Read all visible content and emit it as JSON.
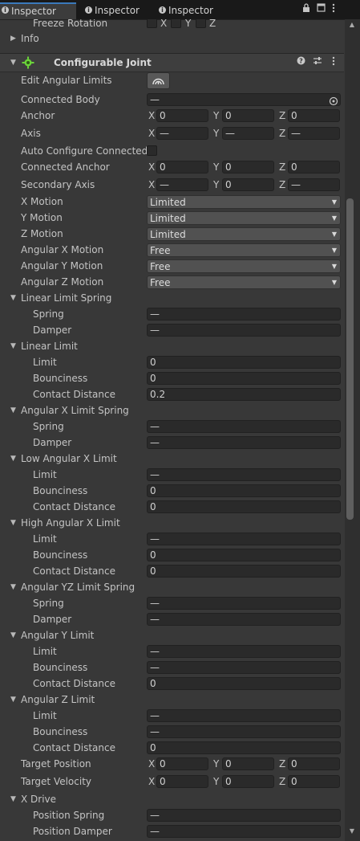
{
  "tabs": [
    {
      "label": "Inspector",
      "active": true
    },
    {
      "label": "Inspector",
      "active": false
    },
    {
      "label": "Inspector",
      "active": false
    }
  ],
  "tab_controls": {
    "lock_icon": "lock-icon",
    "maximize_icon": "maximize-icon",
    "menu_icon": "kebab-menu-icon"
  },
  "rigidbody": {
    "freeze_rotation_label": "Freeze Rotation",
    "axes": [
      "X",
      "Y",
      "Z"
    ],
    "info_label": "Info"
  },
  "joint": {
    "title": "Configurable Joint",
    "accent_color": "#6bd43a",
    "edit_angular_limits": "Edit Angular Limits",
    "connected_body": {
      "label": "Connected Body",
      "value": "—"
    },
    "anchor": {
      "label": "Anchor",
      "x": "0",
      "y": "0",
      "z": "0"
    },
    "axis": {
      "label": "Axis",
      "x": "—",
      "y": "—",
      "z": "—"
    },
    "auto_configure": "Auto Configure Connected A",
    "connected_anchor": {
      "label": "Connected Anchor",
      "x": "0",
      "y": "0",
      "z": "0"
    },
    "secondary_axis": {
      "label": "Secondary Axis",
      "x": "—",
      "y": "0",
      "z": "—"
    },
    "motions": [
      {
        "label": "X Motion",
        "value": "Limited"
      },
      {
        "label": "Y Motion",
        "value": "Limited"
      },
      {
        "label": "Z Motion",
        "value": "Limited"
      },
      {
        "label": "Angular X Motion",
        "value": "Free"
      },
      {
        "label": "Angular Y Motion",
        "value": "Free"
      },
      {
        "label": "Angular Z Motion",
        "value": "Free"
      }
    ],
    "linear_limit_spring": {
      "title": "Linear Limit Spring",
      "spring_label": "Spring",
      "spring": "—",
      "damper_label": "Damper",
      "damper": "—"
    },
    "linear_limit": {
      "title": "Linear Limit",
      "limit_label": "Limit",
      "limit": "0",
      "bounciness_label": "Bounciness",
      "bounciness": "0",
      "contact_label": "Contact Distance",
      "contact": "0.2"
    },
    "angular_x_limit_spring": {
      "title": "Angular X Limit Spring",
      "spring_label": "Spring",
      "spring": "—",
      "damper_label": "Damper",
      "damper": "—"
    },
    "low_angular_x_limit": {
      "title": "Low Angular X Limit",
      "limit_label": "Limit",
      "limit": "—",
      "bounciness_label": "Bounciness",
      "bounciness": "0",
      "contact_label": "Contact Distance",
      "contact": "0"
    },
    "high_angular_x_limit": {
      "title": "High Angular X Limit",
      "limit_label": "Limit",
      "limit": "—",
      "bounciness_label": "Bounciness",
      "bounciness": "0",
      "contact_label": "Contact Distance",
      "contact": "0"
    },
    "angular_yz_limit_spring": {
      "title": "Angular YZ Limit Spring",
      "spring_label": "Spring",
      "spring": "—",
      "damper_label": "Damper",
      "damper": "—"
    },
    "angular_y_limit": {
      "title": "Angular Y Limit",
      "limit_label": "Limit",
      "limit": "—",
      "bounciness_label": "Bounciness",
      "bounciness": "—",
      "contact_label": "Contact Distance",
      "contact": "0"
    },
    "angular_z_limit": {
      "title": "Angular Z Limit",
      "limit_label": "Limit",
      "limit": "—",
      "bounciness_label": "Bounciness",
      "bounciness": "—",
      "contact_label": "Contact Distance",
      "contact": "0"
    },
    "target_position": {
      "label": "Target Position",
      "x": "0",
      "y": "0",
      "z": "0"
    },
    "target_velocity": {
      "label": "Target Velocity",
      "x": "0",
      "y": "0",
      "z": "0"
    },
    "x_drive": {
      "title": "X Drive",
      "position_spring_label": "Position Spring",
      "position_spring": "—",
      "position_damper_label": "Position Damper",
      "position_damper": "—"
    }
  }
}
